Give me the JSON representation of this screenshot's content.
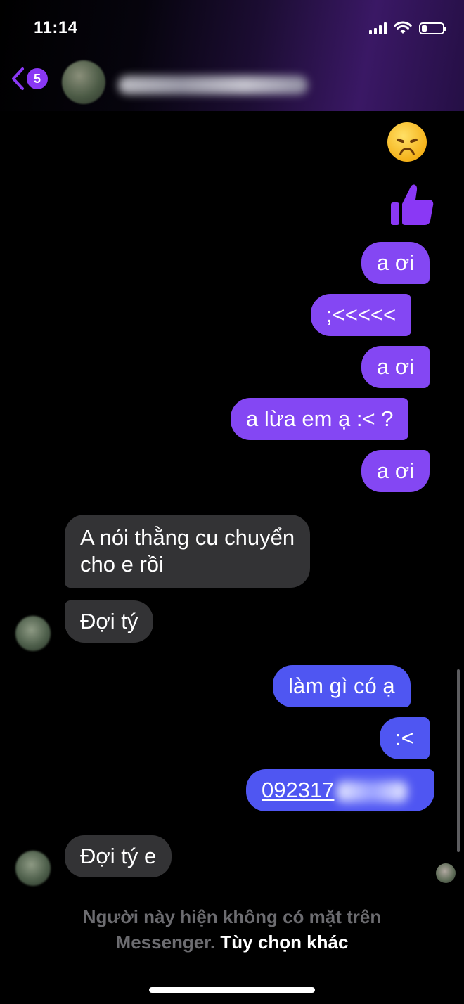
{
  "status_bar": {
    "time": "11:14",
    "battery_level": 0.25
  },
  "header": {
    "back_badge": "5",
    "accent_color": "#8a38f5"
  },
  "messages": [
    {
      "side": "out",
      "type": "emoji",
      "icon": "disappointed-face-emoji"
    },
    {
      "side": "out",
      "type": "like",
      "icon": "thumbs-up-icon"
    },
    {
      "side": "out",
      "text": "a ơi"
    },
    {
      "side": "out",
      "text": ";<<<<<"
    },
    {
      "side": "out",
      "text": "a ơi"
    },
    {
      "side": "out",
      "text": "a lừa em ạ :< ?"
    },
    {
      "side": "out",
      "text": "a ơi"
    },
    {
      "side": "in",
      "lines": [
        "A nói thằng cu chuyển",
        "cho e rồi"
      ]
    },
    {
      "side": "in",
      "text": "Đợi tý"
    },
    {
      "side": "out",
      "text": "làm gì có ạ"
    },
    {
      "side": "out",
      "text": ":<"
    },
    {
      "side": "out",
      "type": "phone",
      "text": "092317"
    },
    {
      "side": "in",
      "text": "Đợi tý e"
    }
  ],
  "footer": {
    "notice": "Người này hiện không có mặt trên Messenger.",
    "link": "Tùy chọn khác"
  },
  "colors": {
    "outgoing_purple": "#8447f3",
    "outgoing_blue": "#4f56f2",
    "incoming_gray": "#333335",
    "background": "#000000"
  }
}
